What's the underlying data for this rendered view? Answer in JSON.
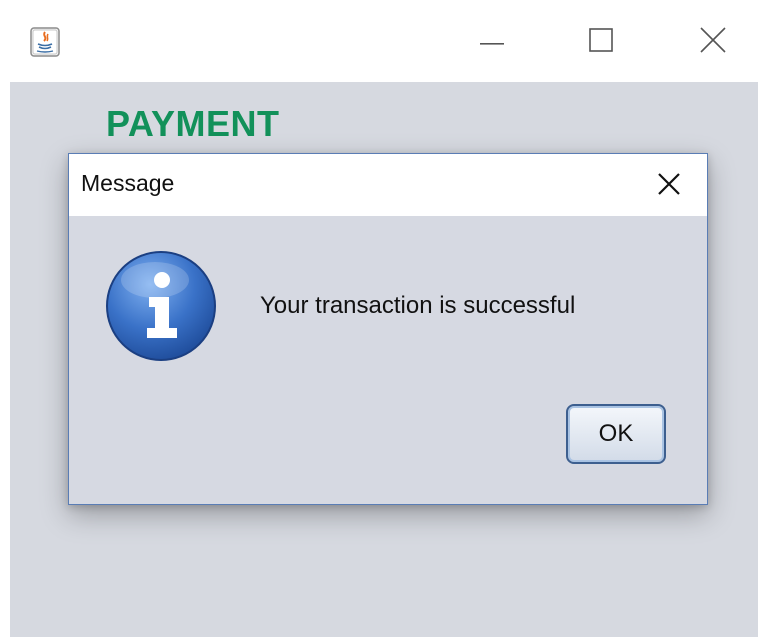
{
  "window": {
    "title_icon": "java-app-icon",
    "controls": [
      "minimize-icon",
      "maximize-icon",
      "close-icon"
    ]
  },
  "main": {
    "heading": "PAYMENT",
    "heading_color": "#12915a"
  },
  "dialog": {
    "title": "Message",
    "icon": "info-icon",
    "message": "Your transaction is successful",
    "ok_label": "OK",
    "border_color": "#5a7db5"
  }
}
